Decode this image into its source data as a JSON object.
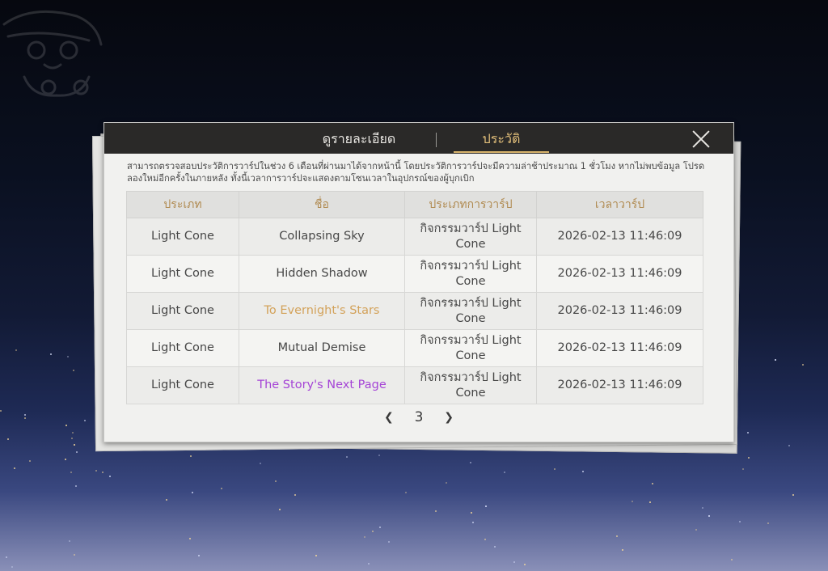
{
  "tabs": {
    "detail": "ดูรายละเอียด",
    "history": "ประวัติ"
  },
  "notice": "สามารถตรวจสอบประวัติการวาร์ปในช่วง 6 เดือนที่ผ่านมาได้จากหน้านี้ โดยประวัติการวาร์ปจะมีความล่าช้าประมาณ 1 ชั่วโมง หากไม่พบข้อมูล โปรดลองใหม่อีกครั้งในภายหลัง ทั้งนี้เวลาการวาร์ปจะแสดงตามโซนเวลาในอุปกรณ์ของผู้บุกเบิก",
  "table": {
    "headers": [
      "ประเภท",
      "ชื่อ",
      "ประเภทการวาร์ป",
      "เวลาวาร์ป"
    ],
    "rows": [
      {
        "type": "Light Cone",
        "name": "Collapsing Sky",
        "warp": "กิจกรรมวาร์ป Light Cone",
        "time": "2026-02-13 11:46:09",
        "color": "#474747"
      },
      {
        "type": "Light Cone",
        "name": "Hidden Shadow",
        "warp": "กิจกรรมวาร์ป Light Cone",
        "time": "2026-02-13 11:46:09",
        "color": "#474747"
      },
      {
        "type": "Light Cone",
        "name": "To Evernight's Stars",
        "warp": "กิจกรรมวาร์ป Light Cone",
        "time": "2026-02-13 11:46:09",
        "color": "#d3a25a"
      },
      {
        "type": "Light Cone",
        "name": "Mutual Demise",
        "warp": "กิจกรรมวาร์ป Light Cone",
        "time": "2026-02-13 11:46:09",
        "color": "#474747"
      },
      {
        "type": "Light Cone",
        "name": "The Story's Next Page",
        "warp": "กิจกรรมวาร์ป Light Cone",
        "time": "2026-02-13 11:46:09",
        "color": "#a544d6"
      }
    ]
  },
  "pager": {
    "page": "3",
    "prev_icon": "chevron-left-icon",
    "next_icon": "chevron-right-icon"
  },
  "close_icon": "close-icon"
}
